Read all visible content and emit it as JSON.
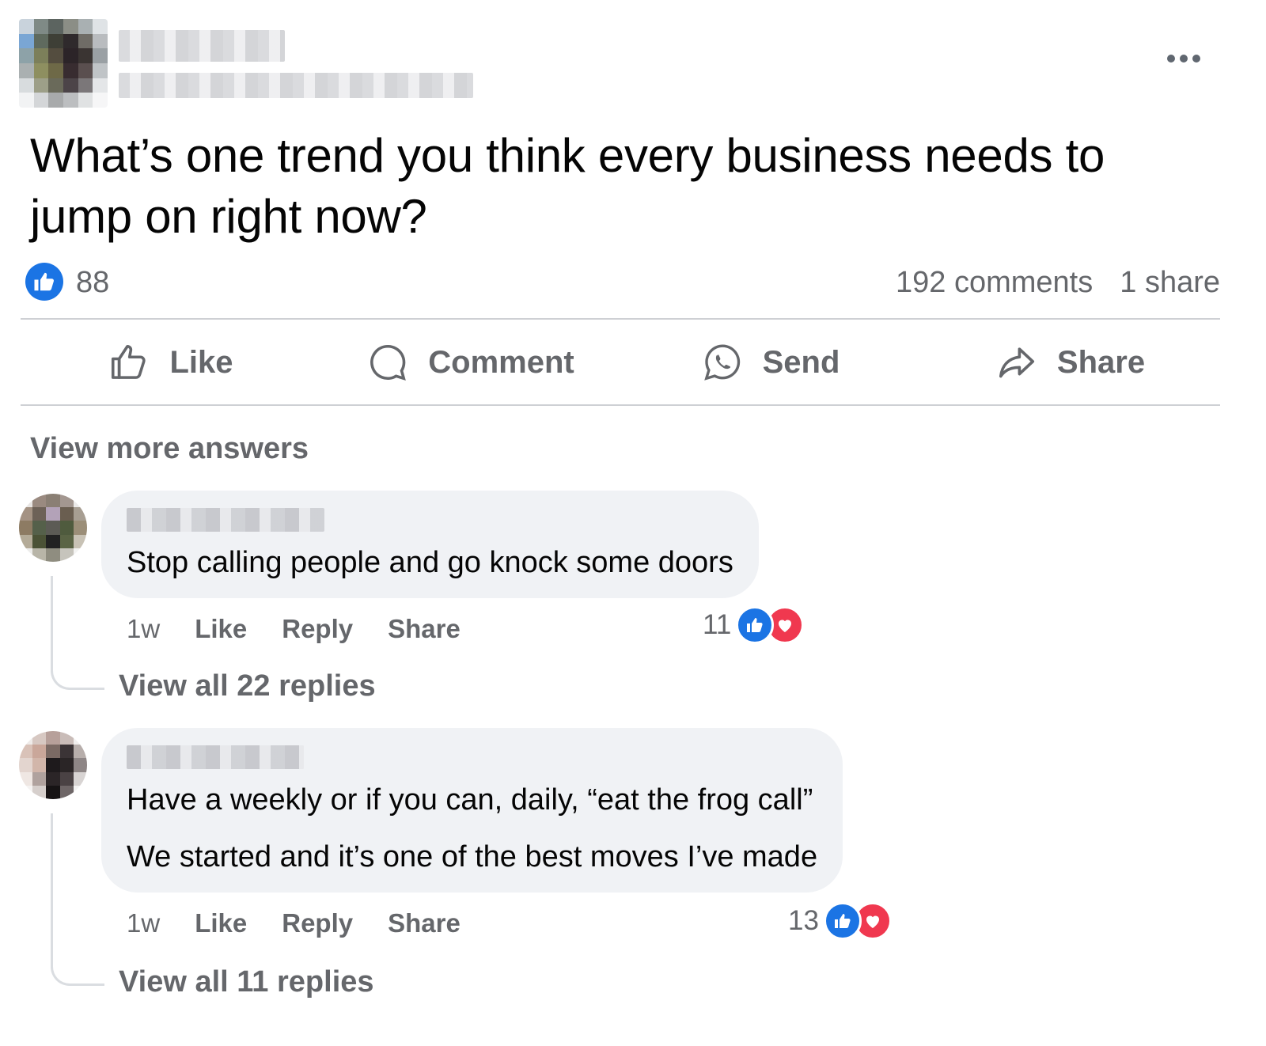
{
  "post": {
    "text": "What’s one trend you think every business needs to jump on right now?",
    "more_icon": "more-horizontal-icon"
  },
  "stats": {
    "like_count": "88",
    "comments": "192 comments",
    "shares": "1 share"
  },
  "actions": [
    {
      "label": "Like",
      "icon": "thumbs-up-icon"
    },
    {
      "label": "Comment",
      "icon": "comment-icon"
    },
    {
      "label": "Send",
      "icon": "whatsapp-send-icon"
    },
    {
      "label": "Share",
      "icon": "share-arrow-icon"
    }
  ],
  "view_more": "View more answers",
  "comments": [
    {
      "lines": [
        "Stop calling people and go knock some doors"
      ],
      "time": "1w",
      "like": "Like",
      "reply": "Reply",
      "share": "Share",
      "reactions": "11",
      "view_replies": "View all 22 replies"
    },
    {
      "lines": [
        "Have a weekly or if you can, daily, “eat the frog call”",
        "We started and it’s one of the best moves I’ve made"
      ],
      "time": "1w",
      "like": "Like",
      "reply": "Reply",
      "share": "Share",
      "reactions": "13",
      "view_replies": "View all 11 replies"
    }
  ],
  "colors": {
    "accent": "#1b74e4",
    "love": "#f0384f",
    "secondary_text": "#65676b",
    "bubble": "#f0f2f5"
  }
}
